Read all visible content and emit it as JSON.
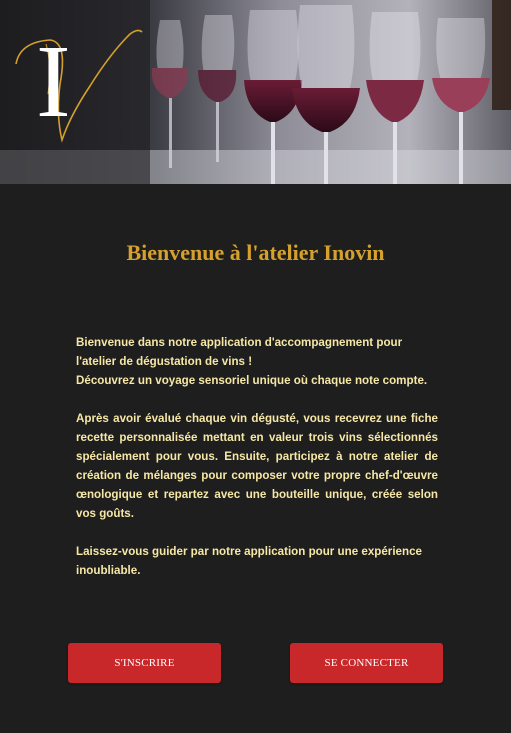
{
  "brand": {
    "logo_letter": "I",
    "accent_color": "#d5a02b",
    "logo_icon": "script-v-monogram-icon"
  },
  "hero": {
    "image": "red-wine-glasses-photo"
  },
  "welcome": {
    "title": "Bienvenue à l'atelier Inovin",
    "intro_line1": "Bienvenue dans notre application d'accompagnement pour l'atelier de dégustation de vins !",
    "intro_line2": "Découvrez un voyage sensoriel unique où chaque note compte.",
    "body": "Après avoir évalué chaque vin dégusté, vous recevrez une fiche recette personnalisée mettant en valeur trois vins sélectionnés spécialement pour vous. Ensuite, participez à notre atelier de création de mélanges pour composer votre propre chef-d'œuvre œnologique et repartez avec une bouteille unique, créée selon vos goûts.",
    "closing": "Laissez-vous guider par notre application pour une expérience inoubliable."
  },
  "actions": {
    "signup_label": "S'INSCRIRE",
    "login_label": "SE CONNECTER",
    "button_color": "#c8282a"
  }
}
